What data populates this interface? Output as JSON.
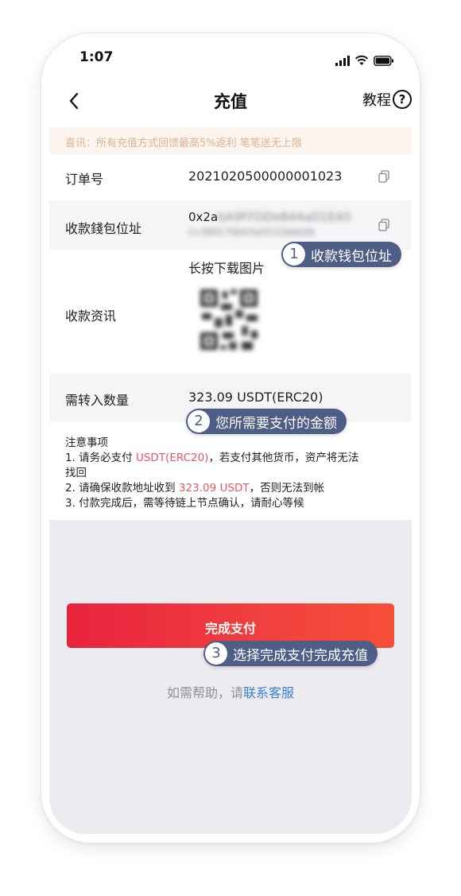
{
  "status_bar": {
    "time": "1:07"
  },
  "header": {
    "title": "充值",
    "tutorial_label": "教程",
    "help_symbol": "?"
  },
  "notice": "喜讯：所有充值方式回馈最高5%返利 笔笔送无上限",
  "order": {
    "label": "订单号",
    "value": "2021020500000001023"
  },
  "wallet": {
    "label": "收款錢包位址",
    "address_prefix": "0x2a",
    "address_rest_line1": "bA9FFDDeB44aD1EA5",
    "address_line2": "Cc38917​6b03a5532bbb0b"
  },
  "payment_info": {
    "label": "收款资讯",
    "qr_hint": "长按下载图片"
  },
  "amount": {
    "label": "需转入数量",
    "value": "323.09 USDT(ERC20)"
  },
  "notes": {
    "title": "注意事项",
    "line1_prefix": "1. 请务必支付 ",
    "line1_highlight": "USDT(ERC20)",
    "line1_suffix": "，若支付其他货币，资产将无法",
    "line1_cont": "找回",
    "line2_prefix": "2. 请确保收款地址收到 ",
    "line2_highlight": "323.09 USDT",
    "line2_suffix": "，否则无法到帐",
    "line3": "3. 付款完成后，需等待链上节点确认，请耐心等候"
  },
  "callouts": [
    {
      "num": "1",
      "text": "收款钱包位址"
    },
    {
      "num": "2",
      "text": "您所需要支付的金额"
    },
    {
      "num": "3",
      "text": "选择完成支付完成充值"
    }
  ],
  "pay_button": {
    "label": "完成支付"
  },
  "help": {
    "prefix": "如需帮助，请",
    "link": "联系客服"
  },
  "colors": {
    "accent_red": "#e8233d",
    "callout_bg": "#4f5e86",
    "link_blue": "#3b7fd6",
    "notice_text": "#e0b48c"
  }
}
